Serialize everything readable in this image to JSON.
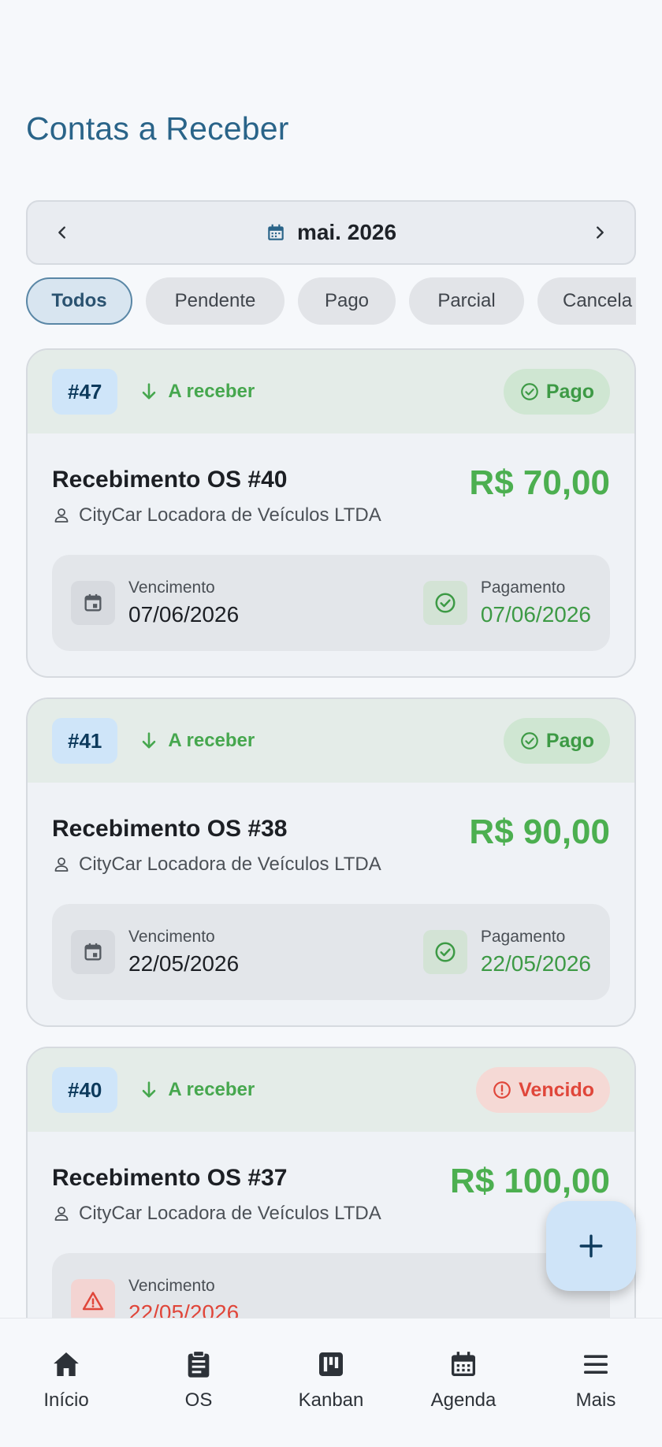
{
  "page": {
    "title": "Contas a Receber"
  },
  "month": {
    "label": "mai. 2026"
  },
  "filters": [
    "Todos",
    "Pendente",
    "Pago",
    "Parcial",
    "Cancela"
  ],
  "cards": [
    {
      "id": "#47",
      "direction": "A receber",
      "status": "Pago",
      "description": "Recebimento OS #40",
      "amount": "R$ 70,00",
      "client": "CityCar Locadora de Veículos LTDA",
      "due_label": "Vencimento",
      "due_date": "07/06/2026",
      "pay_label": "Pagamento",
      "pay_date": "07/06/2026"
    },
    {
      "id": "#41",
      "direction": "A receber",
      "status": "Pago",
      "description": "Recebimento OS #38",
      "amount": "R$ 90,00",
      "client": "CityCar Locadora de Veículos LTDA",
      "due_label": "Vencimento",
      "due_date": "22/05/2026",
      "pay_label": "Pagamento",
      "pay_date": "22/05/2026"
    },
    {
      "id": "#40",
      "direction": "A receber",
      "status": "Vencido",
      "description": "Recebimento OS #37",
      "amount": "R$ 100,00",
      "client": "CityCar Locadora de Veículos LTDA",
      "due_label": "Vencimento",
      "due_date": "22/05/2026"
    }
  ],
  "nav": [
    "Início",
    "OS",
    "Kanban",
    "Agenda",
    "Mais"
  ],
  "colors": {
    "accent": "#2a6489",
    "paid_green": "#4caf50",
    "overdue_red": "#e0463a",
    "id_badge_bg": "#cfe5f9"
  }
}
